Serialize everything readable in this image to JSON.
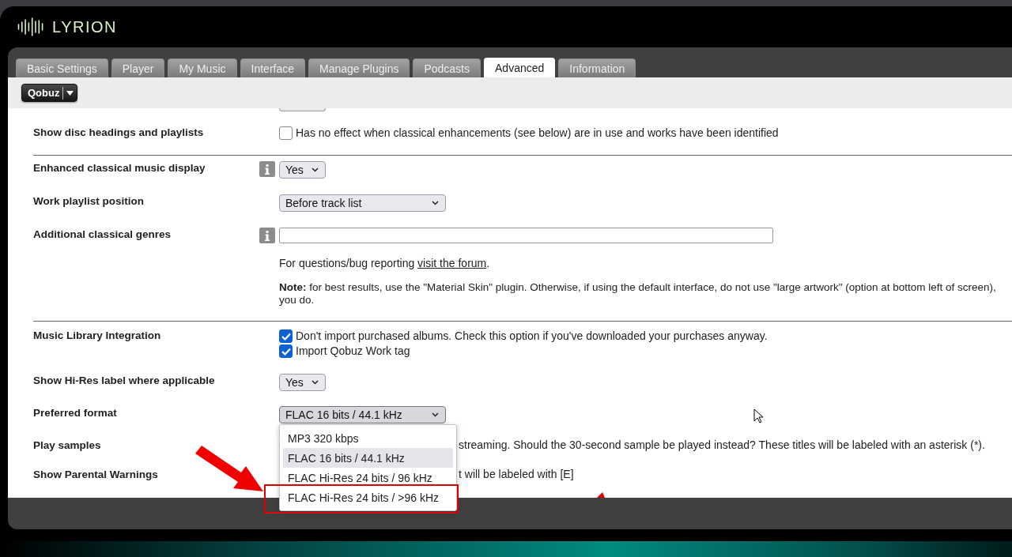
{
  "app": {
    "name": "LYRION"
  },
  "tabs": [
    {
      "label": "Basic Settings",
      "selected": false
    },
    {
      "label": "Player",
      "selected": false
    },
    {
      "label": "My Music",
      "selected": false
    },
    {
      "label": "Interface",
      "selected": false
    },
    {
      "label": "Manage Plugins",
      "selected": false
    },
    {
      "label": "Podcasts",
      "selected": false
    },
    {
      "label": "Advanced",
      "selected": true
    },
    {
      "label": "Information",
      "selected": false
    }
  ],
  "plugin_menu": {
    "label": "Qobuz"
  },
  "sections": [
    {
      "rows": [
        {
          "kind": "checkbox",
          "label": "Show disc headings and playlists",
          "info": false,
          "checked": false,
          "text": "Has no effect when classical enhancements (see below) are in use and works have been identified"
        }
      ]
    },
    {
      "rows": [
        {
          "kind": "select",
          "label": "Enhanced classical music display",
          "info": true,
          "value": "Yes",
          "expanded": false
        },
        {
          "kind": "select",
          "label": "Work playlist position",
          "info": false,
          "value": "Before track list",
          "expanded": false
        },
        {
          "kind": "input",
          "label": "Additional classical genres",
          "info": true,
          "help": {
            "prefix": "For questions/bug reporting ",
            "link": "visit the forum",
            "suffix": "."
          },
          "note": [
            "**Note:** for best results, use the \"Material Skin\" plugin. Otherwise, if using the default interface, do not use \"large artwork\" (option at bottom left of screen),",
            "you do."
          ]
        }
      ]
    },
    {
      "rows": [
        {
          "kind": "checkboxes",
          "label": "Music Library Integration",
          "info": false,
          "options": [
            {
              "text": "Don't import purchased albums. Check this option if you've downloaded your purchases anyway.",
              "checked": true
            },
            {
              "text": "Import Qobuz Work tag",
              "checked": true
            }
          ]
        },
        {
          "kind": "select",
          "label": "Show Hi-Res label where applicable",
          "info": false,
          "value": "Yes",
          "expanded": false
        },
        {
          "kind": "select",
          "label": "Preferred format",
          "info": false,
          "value": "FLAC 16 bits / 44.1 kHz",
          "expanded": true,
          "options": [
            {
              "label": "MP3 320 kbps",
              "selected": false
            },
            {
              "label": "FLAC 16 bits / 44.1 kHz",
              "selected": true
            },
            {
              "label": "FLAC Hi-Res 24 bits / 96 kHz",
              "selected": false
            },
            {
              "label": "FLAC Hi-Res 24 bits / >96 kHz",
              "selected": false
            }
          ]
        },
        {
          "kind": "text",
          "label": "Play samples",
          "info": false,
          "text": "streaming. Should the 30-second sample be played instead? These titles will be labeled with an asterisk (*)."
        },
        {
          "kind": "text",
          "label": "Show Parental Warnings",
          "info": false,
          "text": "t will be labeled with [E]"
        }
      ]
    }
  ]
}
